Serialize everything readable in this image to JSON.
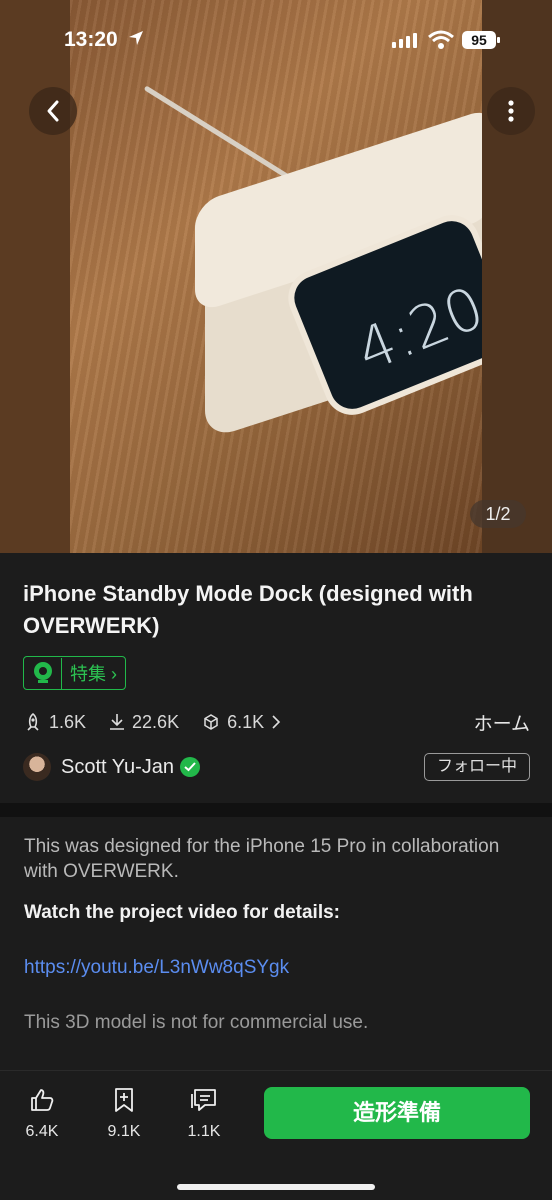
{
  "status": {
    "time": "13:20",
    "battery": "95"
  },
  "hero": {
    "counter": "1/2"
  },
  "title": "iPhone Standby Mode Dock (designed with OVERWERK)",
  "badge": {
    "label": "特集",
    "chevron": "›"
  },
  "stats": {
    "likes_rocket": "1.6K",
    "downloads": "22.6K",
    "makes": "6.1K",
    "home_link": "ホーム"
  },
  "author": {
    "name": "Scott Yu-Jan",
    "follow_label": "フォロー中"
  },
  "description": {
    "line1": "This was designed for the iPhone 15 Pro in collaboration with OVERWERK.",
    "strong": "Watch the project video for details:",
    "link": "https://youtu.be/L3nWw8qSYgk",
    "note": "This 3D model is not for commercial use."
  },
  "actions": {
    "like_count": "6.4K",
    "save_count": "9.1K",
    "comment_count": "1.1K",
    "print_label": "造形準備"
  },
  "colors": {
    "accent": "#22b84a",
    "link": "#5b8df0",
    "background": "#1c1c1c"
  },
  "icons": [
    "location-arrow-icon",
    "signal-icon",
    "wifi-icon",
    "back-icon",
    "more-icon",
    "featured-icon",
    "rocket-icon",
    "download-icon",
    "cube-icon",
    "chevron-right-icon",
    "verified-icon",
    "thumb-up-icon",
    "bookmark-icon",
    "comment-icon"
  ]
}
